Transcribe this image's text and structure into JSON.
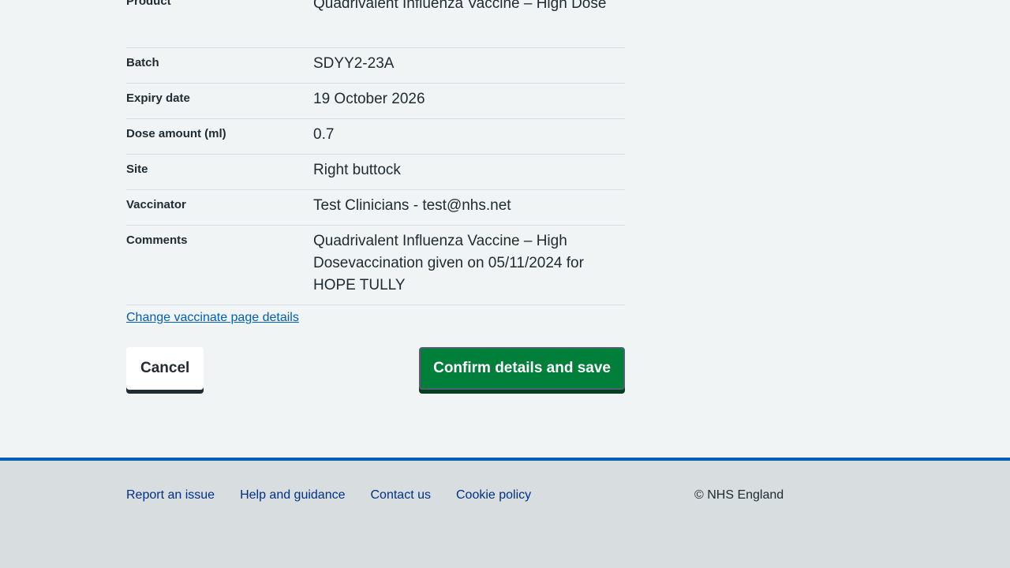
{
  "summary": {
    "rows": [
      {
        "key": "Product",
        "value": "Quadrivalent Influenza Vaccine – High Dose"
      },
      {
        "key": "Batch",
        "value": "SDYY2-23A"
      },
      {
        "key": "Expiry date",
        "value": "19 October 2026"
      },
      {
        "key": "Dose amount (ml)",
        "value": "0.7"
      },
      {
        "key": "Site",
        "value": "Right buttock"
      },
      {
        "key": "Vaccinator",
        "value": "Test Clinicians - test@nhs.net"
      },
      {
        "key": "Comments",
        "value": "Quadrivalent Influenza Vaccine – High Dosevaccination given on 05/11/2024 for HOPE TULLY"
      }
    ]
  },
  "change_link": "Change vaccinate page details",
  "actions": {
    "cancel": "Cancel",
    "confirm": "Confirm details and save"
  },
  "footer": {
    "links": [
      "Report an issue",
      "Help and guidance",
      "Contact us",
      "Cookie policy"
    ],
    "copyright": "© NHS England"
  },
  "colors": {
    "background": "#f0f4f5",
    "link": "#005eb8",
    "primary_button": "#007f3b",
    "footer_border": "#005eb8",
    "footer_bg": "#d8dde0"
  }
}
